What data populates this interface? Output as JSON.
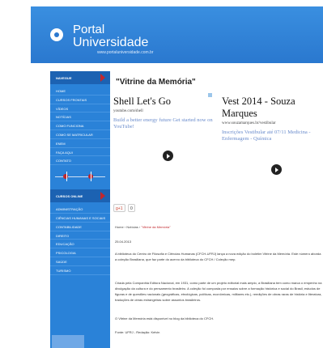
{
  "header": {
    "brand_line1": "Portal",
    "brand_line2": "Universidade",
    "url": "www.portaluniversidade.com.br"
  },
  "sidebar": {
    "main_heading": "NAVEGUE",
    "items": [
      "HOME",
      "CURSOS FRONTAIS",
      "VÍDEOS",
      "NOTÍCIAS",
      "COMO FUNCIONA",
      "COMO SE MATRICULAR",
      "ENEM",
      "FAÇA AQUI",
      "CONTATO"
    ],
    "section_heading": "CURSOS ONLINE",
    "courses": [
      "ADMINISTRAÇÃO",
      "CIÊNCIAS HUMANAS E SOCIAIS",
      "CONTABILIDADE",
      "DIREITO",
      "EDUCAÇÃO",
      "PSICOLOGIA",
      "SAÚDE",
      "TURISMO"
    ]
  },
  "article": {
    "title": "\"Vitrine da Memória\"",
    "breadcrumb_home": "Home",
    "breadcrumb_section": "Notícias",
    "breadcrumb_current": "\"Vitrine da Memória\"",
    "date": "25.04.2013",
    "paragraph1": "A biblioteca do Centro de Filosofia e Ciências Humanas (CFCH-UFRJ) lança a nova edição do boletim Vitrine da Memória. Este número aborda a coleção Brasiliana, que faz parte do acervo da biblioteca do CFCH / Coleção mep.",
    "paragraph2": "Criada pela Companhia Editora Nacional, em 1931, como parte de um projeto editorial mais amplo, a Brasiliana tem como marca o empenho na divulgação da cultura e do pensamento brasileiro. A coleção foi composta por ensaios sobre a formação histórica e social do Brasil, estudos de figuras e de questões nacionais (geográficas, etnológicas, políticas, econômicas, militares etc.), reedições de obras raras de história e literatura, traduções de obras estrangeiras sobre assuntos brasileiros.",
    "paragraph3": "O Vitrine da Memória está disponível no blog da biblioteca do CFCH.",
    "paragraph4": "Fonte: UFRJ - Redação: Kelvin"
  },
  "social": {
    "gplus_label": "g+1",
    "count": "0"
  },
  "ads": [
    {
      "title": "Shell Let's Go",
      "url": "youtube.com/shell",
      "desc": "Build a better energy future Get started now on YouTube!"
    },
    {
      "title": "Vest 2014 - Souza Marques",
      "url": "www.souzamarques.br/vestibular",
      "desc": "Inscrições Vestibular até 07/11 Medicina - Enfermagem - Química"
    }
  ],
  "colors": {
    "header_blue": "#2a78cf",
    "sidebar_blue": "#2a82d8",
    "accent_red": "#c1272d"
  }
}
